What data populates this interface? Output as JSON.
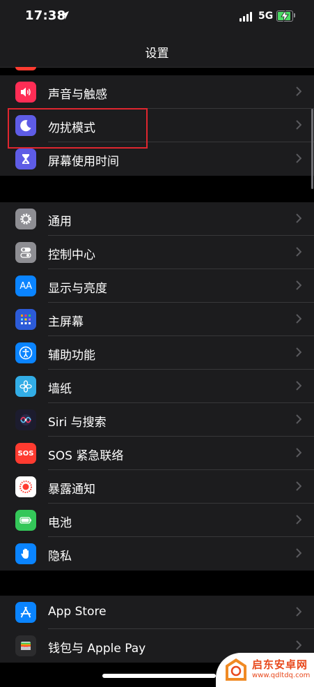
{
  "status_bar": {
    "time": "17:38",
    "network": "5G"
  },
  "nav": {
    "title": "设置"
  },
  "group1": [
    {
      "label": "声音与触感",
      "icon": "speaker-icon",
      "color": "#ff2d55"
    },
    {
      "label": "勿扰模式",
      "icon": "moon-icon",
      "color": "#5e5ce6"
    },
    {
      "label": "屏幕使用时间",
      "icon": "hourglass-icon",
      "color": "#5e5ce6"
    }
  ],
  "group2": [
    {
      "label": "通用",
      "icon": "gear-icon",
      "color": "#8e8e93"
    },
    {
      "label": "控制中心",
      "icon": "toggles-icon",
      "color": "#8e8e93"
    },
    {
      "label": "显示与亮度",
      "icon": "aa-icon",
      "color": "#0a84ff",
      "glyph": "AA"
    },
    {
      "label": "主屏幕",
      "icon": "home-grid-icon",
      "color": "#2c5bd8"
    },
    {
      "label": "辅助功能",
      "icon": "accessibility-icon",
      "color": "#0a84ff"
    },
    {
      "label": "墙纸",
      "icon": "flower-icon",
      "color": "#32ade6"
    },
    {
      "label": "Siri 与搜索",
      "icon": "siri-icon",
      "color": "#1c1c2e"
    },
    {
      "label": "SOS 紧急联络",
      "icon": "sos-icon",
      "color": "#ff3b30",
      "glyph": "SOS"
    },
    {
      "label": "暴露通知",
      "icon": "exposure-icon",
      "color": "#ffffff"
    },
    {
      "label": "电池",
      "icon": "battery-icon",
      "color": "#34c759"
    },
    {
      "label": "隐私",
      "icon": "hand-icon",
      "color": "#0a84ff"
    }
  ],
  "group3": [
    {
      "label": "App Store",
      "icon": "appstore-icon",
      "color": "#0a84ff"
    },
    {
      "label": "钱包与 Apple Pay",
      "icon": "wallet-icon",
      "color": "#2c2c2e"
    }
  ],
  "watermark": {
    "title": "启东安卓网",
    "url": "www.qdltdq.com"
  }
}
